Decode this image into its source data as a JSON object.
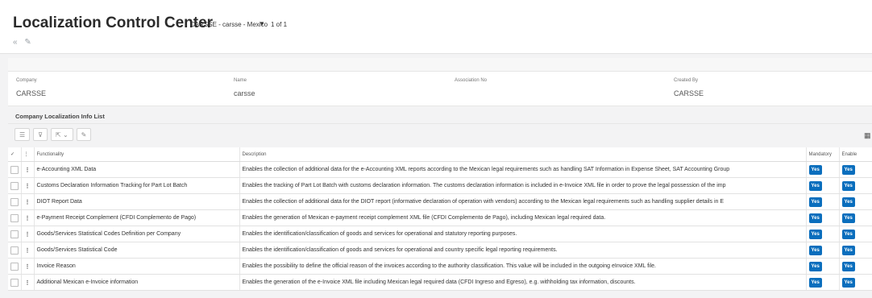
{
  "header": {
    "title": "Localization Control Center",
    "context": "CARSSE - carsse - Mexico",
    "record_count": "1 of 1"
  },
  "icons": {
    "back": "«",
    "edit": "✎",
    "context_caret": "▼",
    "list_view": "☰",
    "filter": "⊽",
    "export": "⇱",
    "export_caret": "⌄",
    "toolbar_edit": "✎",
    "grid_settings": "▦",
    "checkmark": "✓",
    "kebab": "⋮"
  },
  "record": {
    "company_label": "Company",
    "company": "CARSSE",
    "name_label": "Name",
    "name": "carsse",
    "association_label": "Association No",
    "association": "",
    "created_by_label": "Created By",
    "created_by": "CARSSE"
  },
  "list": {
    "title": "Company Localization Info List",
    "columns": {
      "functionality": "Functionality",
      "description": "Description",
      "mandatory": "Mandatory",
      "enabled": "Enable"
    },
    "rows": [
      {
        "functionality": "e-Accounting XML Data",
        "description": "Enables the collection of additional data for the e-Accounting XML reports according to the Mexican legal requirements such as handling SAT Information in Expense Sheet, SAT Accounting Group",
        "mandatory": "Yes",
        "enabled": "Yes"
      },
      {
        "functionality": "Customs Declaration Information Tracking for Part Lot Batch",
        "description": "Enables the tracking of Part Lot Batch with customs declaration information. The customs declaration information is included in e-Invoice XML file in order to prove the legal possession of the imp",
        "mandatory": "Yes",
        "enabled": "Yes"
      },
      {
        "functionality": "DIOT Report Data",
        "description": "Enables the collection of additional data for the DIOT report (informative declaration of operation with vendors) according to the Mexican legal requirements such as handling supplier details in E",
        "mandatory": "Yes",
        "enabled": "Yes"
      },
      {
        "functionality": "e-Payment Receipt Complement (CFDI Complemento de Pago)",
        "description": "Enables the generation of Mexican e-payment receipt complement XML file (CFDI Complemento de Pago), including Mexican legal required data.",
        "mandatory": "Yes",
        "enabled": "Yes"
      },
      {
        "functionality": "Goods/Services Statistical Codes Definition per Company",
        "description": "Enables the identification/classification of goods and services for operational and statutory reporting purposes.",
        "mandatory": "Yes",
        "enabled": "Yes"
      },
      {
        "functionality": "Goods/Services Statistical Code",
        "description": "Enables the identification/classification of goods and services for operational and country specific legal reporting requirements.",
        "mandatory": "Yes",
        "enabled": "Yes"
      },
      {
        "functionality": "Invoice Reason",
        "description": "Enables the possibility to define the official reason of the invoices according to the authority classification. This value will be included in the outgoing eInvoice XML file.",
        "mandatory": "Yes",
        "enabled": "Yes"
      },
      {
        "functionality": "Additional Mexican e-Invoice information",
        "description": "Enables the generation of the e-Invoice XML file including Mexican legal required data (CFDI Ingreso and Egreso), e.g. withholding tax information, discounts.",
        "mandatory": "Yes",
        "enabled": "Yes"
      }
    ]
  },
  "colors": {
    "yes_badge": "#0a6ebd",
    "page_bg": "#f3f3f4"
  }
}
